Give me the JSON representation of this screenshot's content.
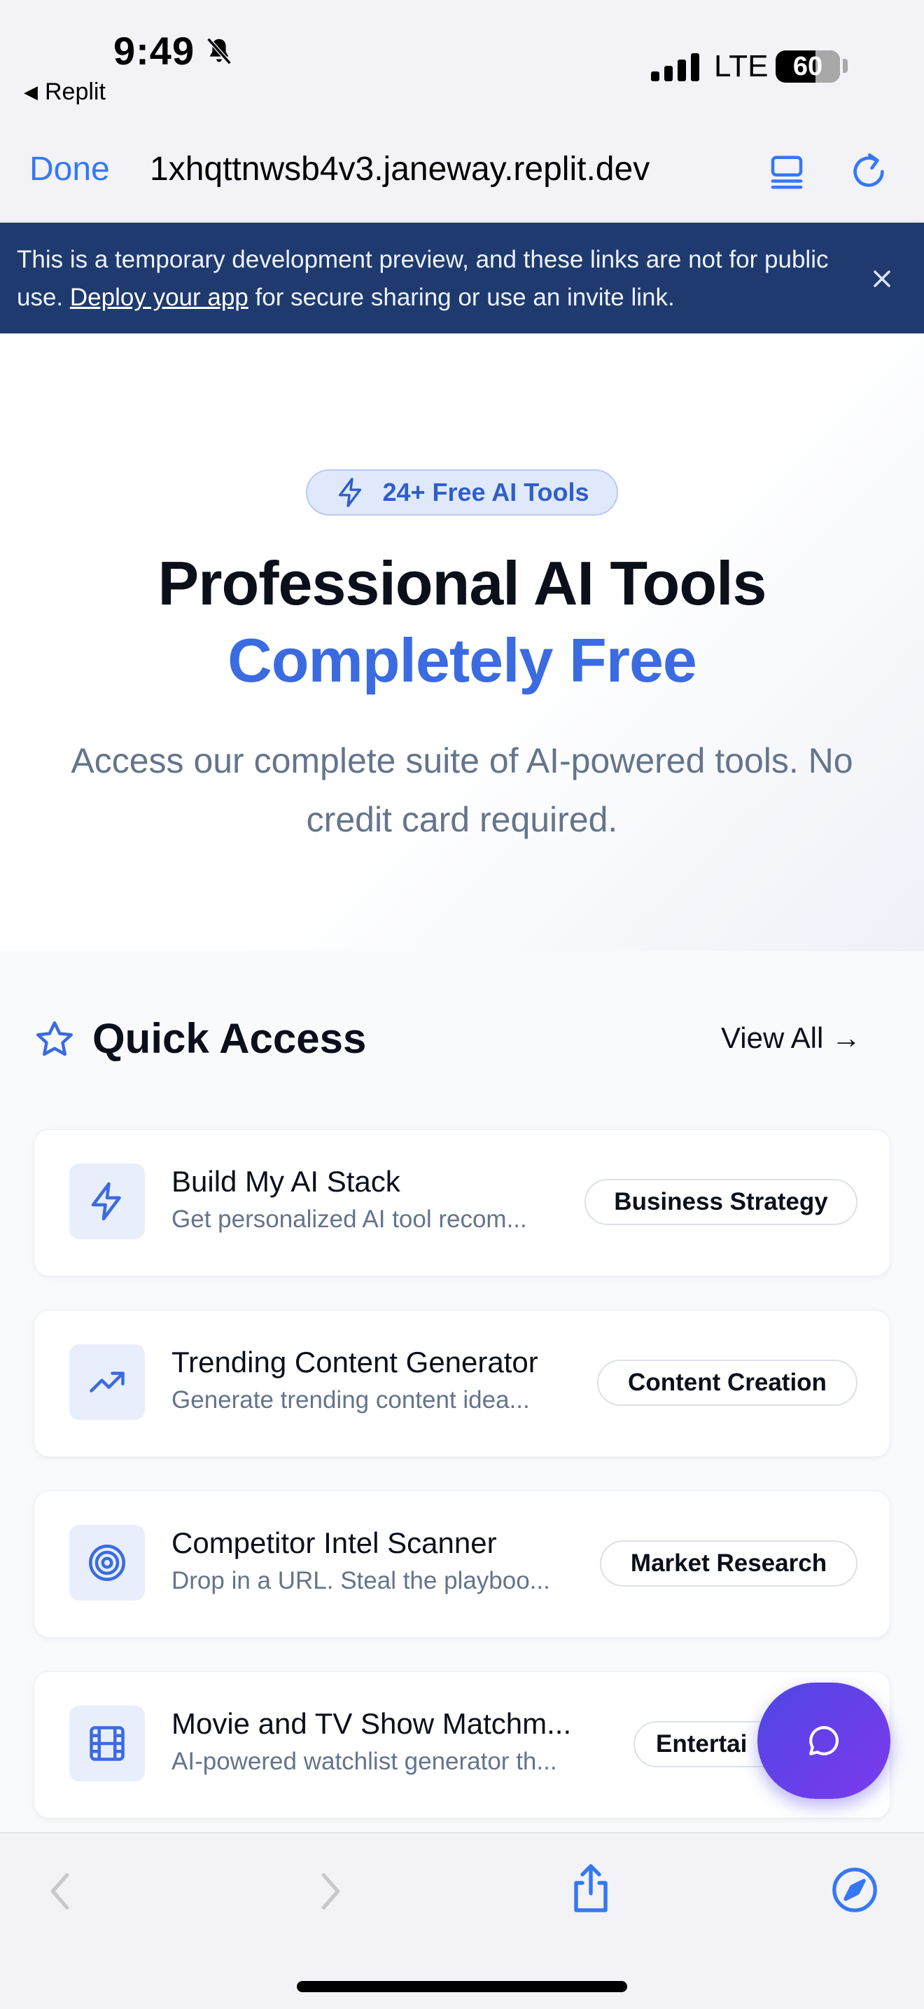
{
  "status_bar": {
    "time": "9:49",
    "back_app": "Replit",
    "network": "LTE",
    "battery": "60"
  },
  "browser": {
    "done_label": "Done",
    "url": "1xhqttnwsb4v3.janeway.replit.dev"
  },
  "banner": {
    "text_before": "This is a temporary development preview, and these links are not for public use. ",
    "link_text": "Deploy your app",
    "text_after": " for secure sharing or use an invite link."
  },
  "hero": {
    "badge": "24+ Free AI Tools",
    "title": "Professional AI Tools",
    "title_accent": "Completely Free",
    "description": "Access our complete suite of AI-powered tools. No credit card required."
  },
  "quick_access": {
    "title": "Quick Access",
    "view_all": "View All →",
    "tools": [
      {
        "name": "Build My AI Stack",
        "description": "Get personalized AI tool recom...",
        "tag": "Business Strategy",
        "icon": "lightning-icon"
      },
      {
        "name": "Trending Content Generator",
        "description": "Generate trending content idea...",
        "tag": "Content Creation",
        "icon": "trending-up-icon"
      },
      {
        "name": "Competitor Intel Scanner",
        "description": "Drop in a URL. Steal the playboo...",
        "tag": "Market Research",
        "icon": "target-icon"
      },
      {
        "name": "Movie and TV Show Matchm...",
        "description": "AI-powered watchlist generator th...",
        "tag": "Entertai",
        "icon": "film-icon"
      }
    ]
  },
  "colors": {
    "accent": "#3b6be0",
    "banner_bg": "#1e3a6e",
    "ios_blue": "#3478f6",
    "fab_start": "#4f46e5",
    "fab_end": "#7c3aed"
  }
}
